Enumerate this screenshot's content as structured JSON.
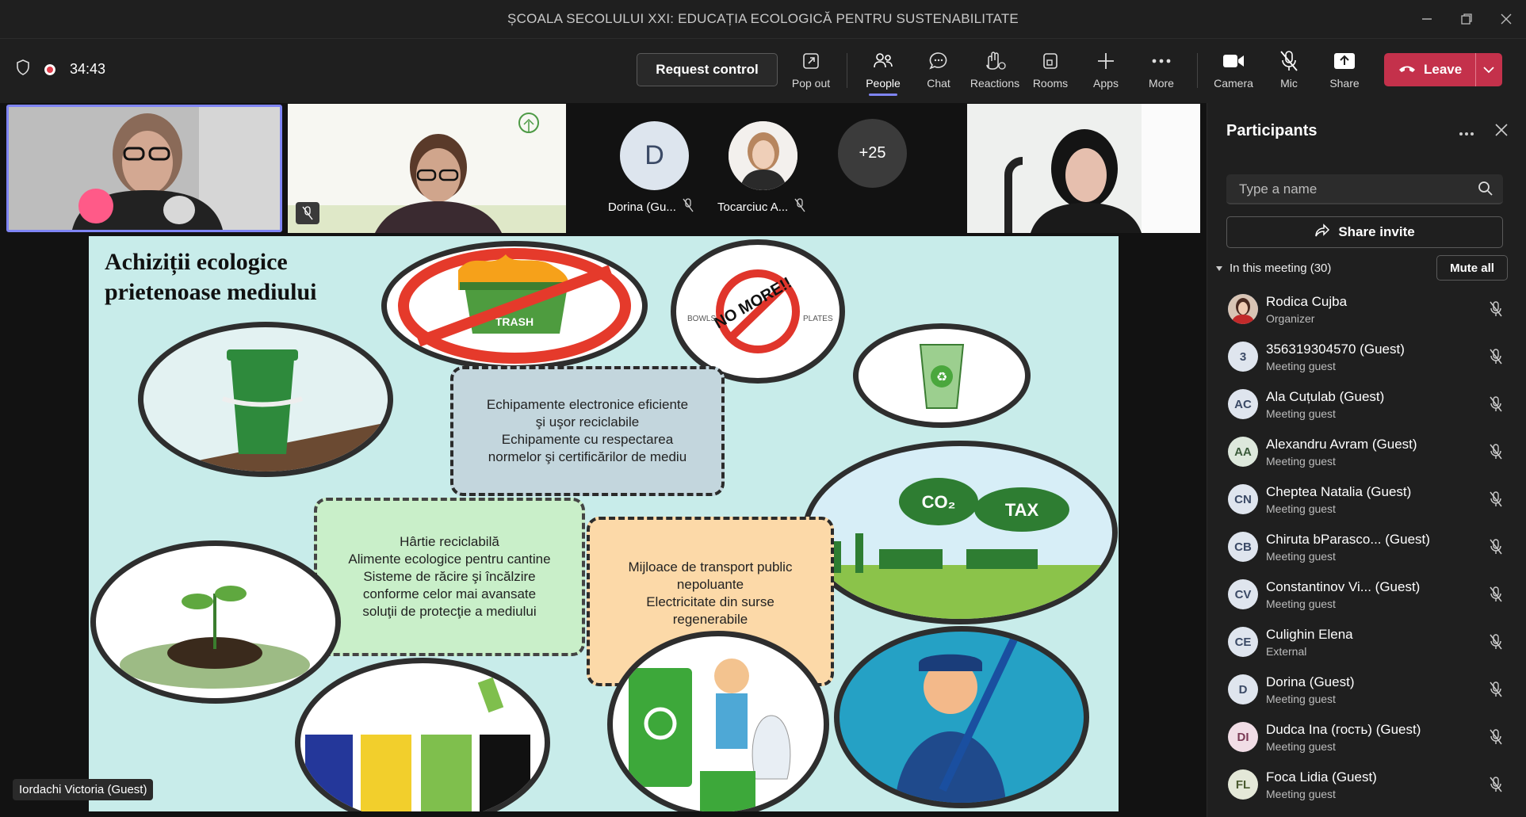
{
  "window": {
    "title": "ȘCOALA SECOLULUI XXI: EDUCAȚIA ECOLOGICĂ PENTRU SUSTENABILITATE"
  },
  "toolbar": {
    "timer": "34:43",
    "request_control": "Request control",
    "buttons": {
      "popout": "Pop out",
      "people": "People",
      "chat": "Chat",
      "reactions": "Reactions",
      "rooms": "Rooms",
      "apps": "Apps",
      "more": "More",
      "camera": "Camera",
      "mic": "Mic",
      "share": "Share"
    },
    "leave": "Leave"
  },
  "gallery": {
    "tile_dorina": {
      "initial": "D",
      "name": "Dorina (Gu..."
    },
    "tile_tocarciuc": {
      "name": "Tocarciuc A..."
    },
    "overflow": "+25"
  },
  "slide": {
    "title_line1": "Achiziții ecologice",
    "title_line2": "prietenoase  mediului",
    "trash_label": "TRASH",
    "no_more_label": "NO MORE!!",
    "bowls_label": "BOWLS",
    "plates_label": "PLATES",
    "co2_label": "CO₂",
    "tax_label": "TAX",
    "box_electronics": [
      "Echipamente electronice eficiente",
      "şi uşor reciclabile",
      "Echipamente cu respectarea",
      "normelor şi certificărilor de mediu"
    ],
    "box_paper": [
      "Hârtie reciclabilă",
      "Alimente ecologice pentru cantine",
      "Sisteme de răcire şi încălzire",
      "conforme celor mai avansate",
      "soluţii de protecţie a mediului"
    ],
    "box_transport": [
      "Mijloace de transport public",
      "nepoluante",
      "Electricitate din surse",
      "regenerabile"
    ]
  },
  "presenter_caption": "Iordachi Victoria (Guest)",
  "participants_panel": {
    "title": "Participants",
    "search_placeholder": "Type a name",
    "share_invite": "Share invite",
    "in_meeting": "In this meeting (30)",
    "mute_all": "Mute all",
    "people": [
      {
        "initials": "",
        "name": "Rodica Cujba",
        "role": "Organizer"
      },
      {
        "initials": "3",
        "name": "356319304570 (Guest)",
        "role": "Meeting guest"
      },
      {
        "initials": "AC",
        "name": "Ala Cuțulab (Guest)",
        "role": "Meeting guest"
      },
      {
        "initials": "AA",
        "name": "Alexandru Avram (Guest)",
        "role": "Meeting guest"
      },
      {
        "initials": "CN",
        "name": "Cheptea Natalia (Guest)",
        "role": "Meeting guest"
      },
      {
        "initials": "CB",
        "name": "Chiruta bParasco... (Guest)",
        "role": "Meeting guest"
      },
      {
        "initials": "CV",
        "name": "Constantinov Vi...  (Guest)",
        "role": "Meeting guest"
      },
      {
        "initials": "CE",
        "name": "Culighin Elena",
        "role": "External"
      },
      {
        "initials": "D",
        "name": "Dorina (Guest)",
        "role": "Meeting guest"
      },
      {
        "initials": "DI",
        "name": "Dudca Ina (гость) (Guest)",
        "role": "Meeting guest"
      },
      {
        "initials": "FL",
        "name": "Foca Lidia (Guest)",
        "role": "Meeting guest"
      }
    ]
  },
  "colors": {
    "accent": "#7f85f5",
    "leave": "#c4314b",
    "slide_bg": "#c8ecea"
  }
}
